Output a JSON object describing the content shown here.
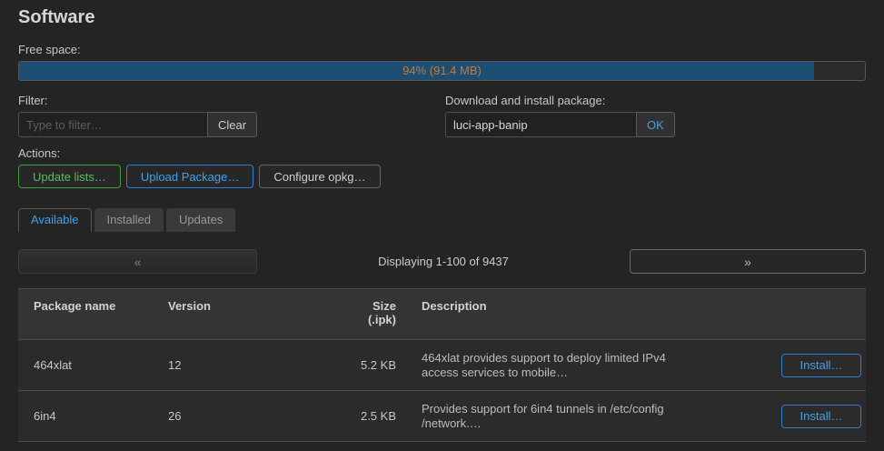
{
  "title": "Software",
  "free_space": {
    "label": "Free space:",
    "percent": 94,
    "display": "94% (91.4 MB)"
  },
  "filter": {
    "label": "Filter:",
    "placeholder": "Type to filter…",
    "clear": "Clear"
  },
  "download": {
    "label": "Download and install package:",
    "value": "luci-app-banip",
    "ok": "OK"
  },
  "actions": {
    "label": "Actions:",
    "update_lists": "Update lists…",
    "upload_package": "Upload Package…",
    "configure_opkg": "Configure opkg…"
  },
  "tabs": {
    "available": "Available",
    "installed": "Installed",
    "updates": "Updates"
  },
  "pagination": {
    "prev": "«",
    "status": "Displaying 1-100 of 9437",
    "next": "»"
  },
  "table": {
    "headers": {
      "package": "Package name",
      "version": "Version",
      "size_line1": "Size",
      "size_line2": "(.ipk)",
      "description": "Description"
    },
    "rows": [
      {
        "name": "464xlat",
        "version": "12",
        "size": "5.2 KB",
        "desc_line1": "464xlat provides support to deploy limited IPv4",
        "desc_line2": "access services to mobile…",
        "action": "Install…"
      },
      {
        "name": "6in4",
        "version": "26",
        "size": "2.5 KB",
        "desc_line1": "Provides support for 6in4 tunnels in /etc/config",
        "desc_line2": "/network.…",
        "action": "Install…"
      }
    ]
  },
  "colors": {
    "accent_blue": "#41a1e8",
    "accent_green": "#63b763",
    "progress_fill": "#1d4e74",
    "progress_text": "#c07b3e"
  }
}
